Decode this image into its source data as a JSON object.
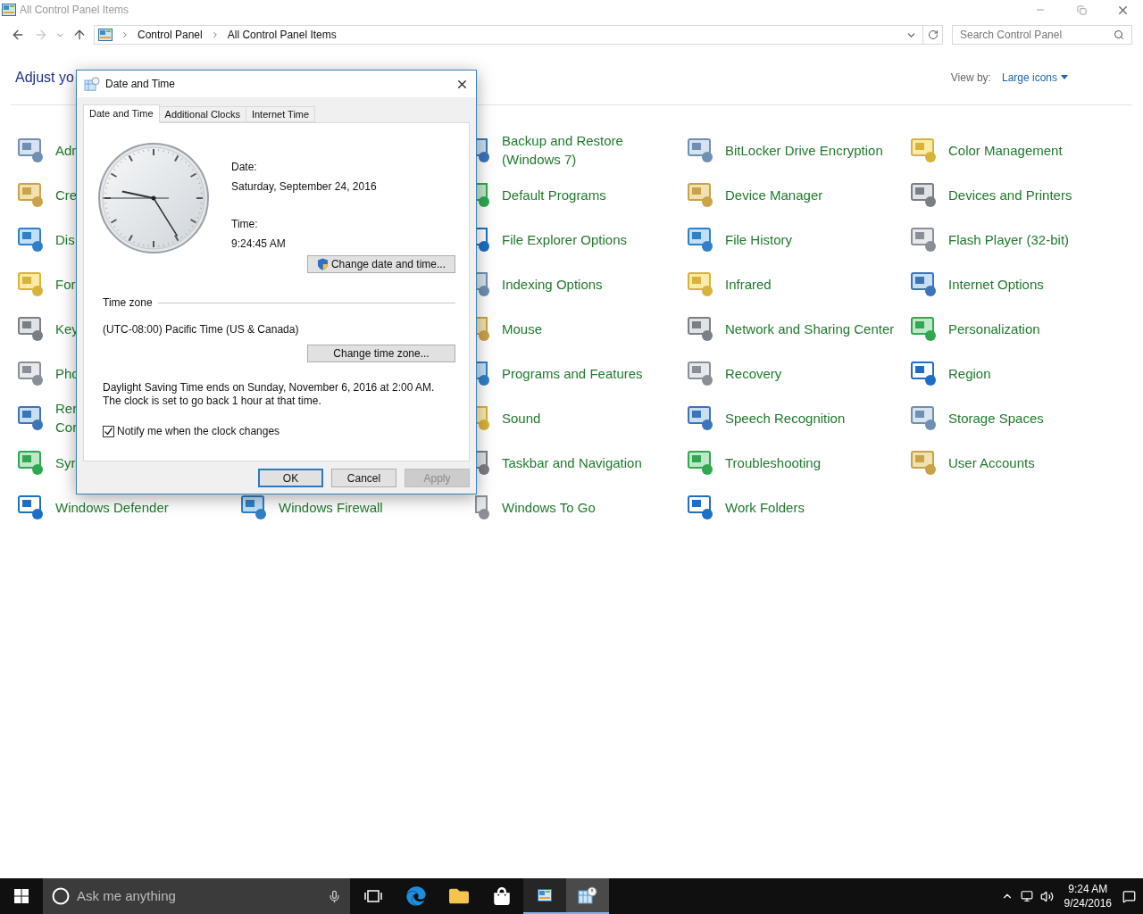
{
  "window": {
    "title": "All Control Panel Items"
  },
  "address_bar": {
    "breadcrumbs": [
      "Control Panel",
      "All Control Panel Items"
    ]
  },
  "search": {
    "placeholder": "Search Control Panel"
  },
  "header": {
    "title": "Adjust yo",
    "view_by_label": "View by:",
    "view_by_value": "Large icons"
  },
  "columns": [
    [
      {
        "label": "Adr"
      },
      {
        "label": "Cre"
      },
      {
        "label": "Dis"
      },
      {
        "label": "For"
      },
      {
        "label": "Key"
      },
      {
        "label": "Pho"
      },
      {
        "label": "Rer Cor"
      },
      {
        "label": "Syr"
      },
      {
        "label": "Windows Defender"
      }
    ],
    [
      {
        "label": "Windows Firewall"
      }
    ],
    [
      {
        "label": "Backup and Restore (Windows 7)"
      },
      {
        "label": "Default Programs"
      },
      {
        "label": "File Explorer Options"
      },
      {
        "label": "Indexing Options"
      },
      {
        "label": "Mouse"
      },
      {
        "label": "Programs and Features"
      },
      {
        "label": "Sound"
      },
      {
        "label": "Taskbar and Navigation"
      },
      {
        "label": "Windows To Go"
      }
    ],
    [
      {
        "label": "BitLocker Drive Encryption"
      },
      {
        "label": "Device Manager"
      },
      {
        "label": "File History"
      },
      {
        "label": "Infrared"
      },
      {
        "label": "Network and Sharing Center"
      },
      {
        "label": "Recovery"
      },
      {
        "label": "Speech Recognition"
      },
      {
        "label": "Troubleshooting"
      },
      {
        "label": "Work Folders"
      }
    ],
    [
      {
        "label": "Color Management"
      },
      {
        "label": "Devices and Printers"
      },
      {
        "label": "Flash Player (32-bit)"
      },
      {
        "label": "Internet Options"
      },
      {
        "label": "Personalization"
      },
      {
        "label": "Region"
      },
      {
        "label": "Storage Spaces"
      },
      {
        "label": "User Accounts"
      }
    ]
  ],
  "dialog": {
    "title": "Date and Time",
    "tabs": [
      {
        "label": "Date and Time",
        "selected": true
      },
      {
        "label": "Additional Clocks",
        "selected": false
      },
      {
        "label": "Internet Time",
        "selected": false
      }
    ],
    "date_label": "Date:",
    "date": "Saturday, September 24, 2016",
    "time_label": "Time:",
    "time": "9:24:45 AM",
    "change_datetime_button": "Change date and time...",
    "timezone_heading": "Time zone",
    "timezone": "(UTC-08:00) Pacific Time (US & Canada)",
    "change_timezone_button": "Change time zone...",
    "dst_note": "Daylight Saving Time ends on Sunday, November 6, 2016 at 2:00 AM. The clock is set to go back 1 hour at that time.",
    "notify": {
      "label": "Notify me when the clock changes",
      "checked": true
    },
    "buttons": [
      {
        "label": "OK",
        "default": true,
        "disabled": false
      },
      {
        "label": "Cancel",
        "default": false,
        "disabled": false
      },
      {
        "label": "Apply",
        "default": false,
        "disabled": true
      }
    ]
  },
  "taskbar": {
    "search_placeholder": "Ask me anything",
    "apps": [
      {
        "kind": "taskview",
        "running": false,
        "selected": false
      },
      {
        "kind": "edge",
        "running": false,
        "selected": false
      },
      {
        "kind": "explorer",
        "running": false,
        "selected": false
      },
      {
        "kind": "store",
        "running": false,
        "selected": false
      },
      {
        "kind": "controlpanel",
        "running": true,
        "selected": false
      },
      {
        "kind": "datetime",
        "running": true,
        "selected": true
      }
    ],
    "clock": {
      "time": "9:24 AM",
      "date": "9/24/2016"
    }
  }
}
